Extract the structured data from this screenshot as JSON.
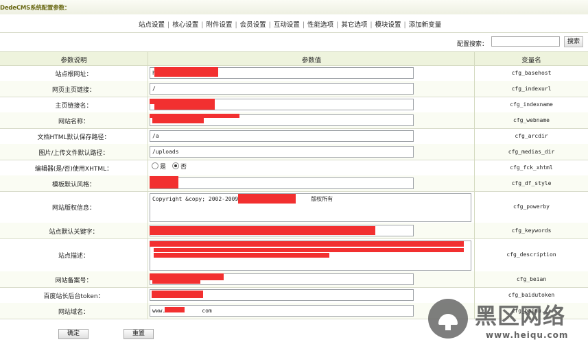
{
  "header": {
    "title": "DedeCMS系统配置参数："
  },
  "tabs": [
    "站点设置",
    "核心设置",
    "附件设置",
    "会员设置",
    "互动设置",
    "性能选项",
    "其它选项",
    "模块设置",
    "添加新变量"
  ],
  "search": {
    "label": "配置搜索：",
    "value": "",
    "button": "搜索"
  },
  "table": {
    "headers": [
      "参数说明",
      "参数值",
      "变量名"
    ],
    "rows": [
      {
        "label": "站点根网址：",
        "value": "h",
        "var": "cfg_basehost",
        "type": "text"
      },
      {
        "label": "网页主页链接：",
        "value": "/",
        "var": "cfg_indexurl",
        "type": "text"
      },
      {
        "label": "主页链接名：",
        "value": "",
        "var": "cfg_indexname",
        "type": "text"
      },
      {
        "label": "网站名称：",
        "value": "",
        "var": "cfg_webname",
        "type": "text"
      },
      {
        "label": "文档HTML默认保存路径：",
        "value": "/a",
        "var": "cfg_arcdir",
        "type": "text"
      },
      {
        "label": "图片/上传文件默认路径：",
        "value": "/uploads",
        "var": "cfg_medias_dir",
        "type": "text"
      },
      {
        "label": "编辑器(是/否)使用XHTML：",
        "options": [
          "是",
          "否"
        ],
        "selected": "否",
        "var": "cfg_fck_xhtml",
        "type": "radio"
      },
      {
        "label": "模板默认风格：",
        "value": "",
        "var": "cfg_df_style",
        "type": "text"
      },
      {
        "label": "网站版权信息：",
        "value_prefix": "Copyright &copy; 2002-2009. ",
        "value_suffix": "版权所有",
        "var": "cfg_powerby",
        "type": "textarea"
      },
      {
        "label": "站点默认关键字：",
        "value": "",
        "var": "cfg_keywords",
        "type": "text"
      },
      {
        "label": "站点描述：",
        "value": "",
        "var": "cfg_description",
        "type": "textarea"
      },
      {
        "label": "网站备案号：",
        "value": "",
        "var": "cfg_beian",
        "type": "text"
      },
      {
        "label": "百度站长后台token：",
        "value": "",
        "var": "cfg_baidutoken",
        "type": "text"
      },
      {
        "label": "网站域名：",
        "value_prefix": "www.",
        "value_suffix": "com",
        "var": "cfg_baidu...",
        "type": "text"
      }
    ]
  },
  "buttons": {
    "confirm": "确定",
    "reset": "重置"
  },
  "watermark": {
    "name": "黑区网络",
    "url": "www.heiqu.com"
  },
  "colors": {
    "redaction": "#f23030",
    "header_bg": "#eef3dd",
    "title_text": "#6b6a16"
  }
}
